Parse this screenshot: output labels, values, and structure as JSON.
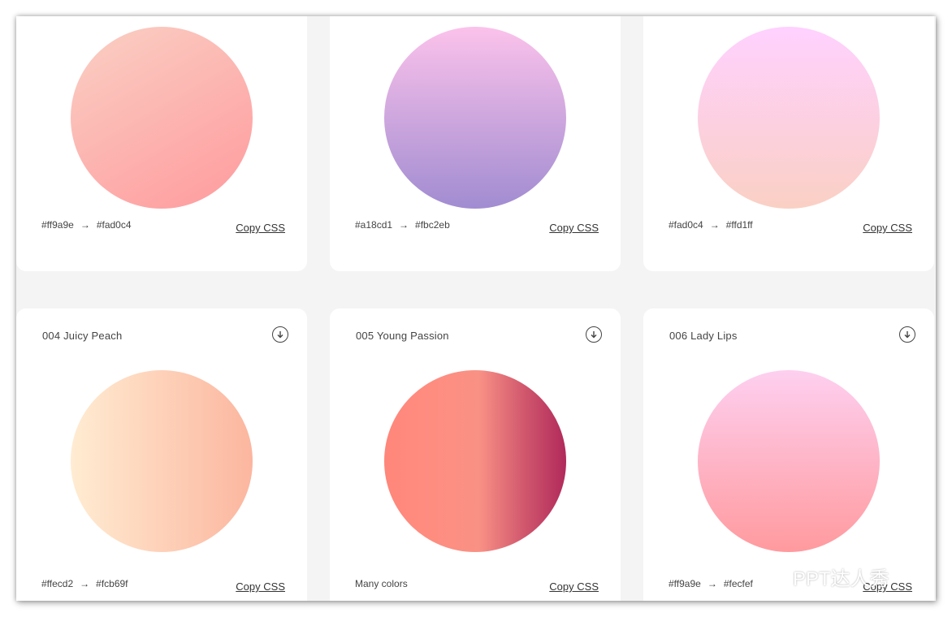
{
  "cards": [
    {
      "title": "",
      "from": "#ff9a9e",
      "to": "#fad0c4",
      "copy": "Copy CSS",
      "gradient": "linear-gradient(-30deg, #ff9a9e 0%, #fad0c4 100%)"
    },
    {
      "title": "",
      "from": "#a18cd1",
      "to": "#fbc2eb",
      "copy": "Copy CSS",
      "gradient": "linear-gradient(to top, #a18cd1 0%, #fbc2eb 100%)"
    },
    {
      "title": "",
      "from": "#fad0c4",
      "to": "#ffd1ff",
      "copy": "Copy CSS",
      "gradient": "linear-gradient(to top, #fad0c4 0%, #ffd1ff 100%)"
    },
    {
      "title": "004 Juicy Peach",
      "from": "#ffecd2",
      "to": "#fcb69f",
      "copy": "Copy CSS",
      "gradient": "linear-gradient(to right, #ffecd2 0%, #fcb69f 100%)"
    },
    {
      "title": "005 Young Passion",
      "colors_text": "Many colors",
      "copy": "Copy CSS",
      "gradient": "linear-gradient(to right, #ff8177 0%, #ff867a 0%, #ff8c7f 21%, #f99185 52%, #cf556c 78%, #b12a5b 100%)"
    },
    {
      "title": "006 Lady Lips",
      "from": "#ff9a9e",
      "to": "#fecfef",
      "copy": "Copy CSS",
      "gradient": "linear-gradient(to top, #ff9a9e 0%, #fecfef 99%, #fecfef 100%)"
    }
  ],
  "arrow": "→",
  "icons": {
    "download": "download-circle-icon",
    "watermark": "wechat-icon"
  },
  "watermark": "PPT达人秀"
}
